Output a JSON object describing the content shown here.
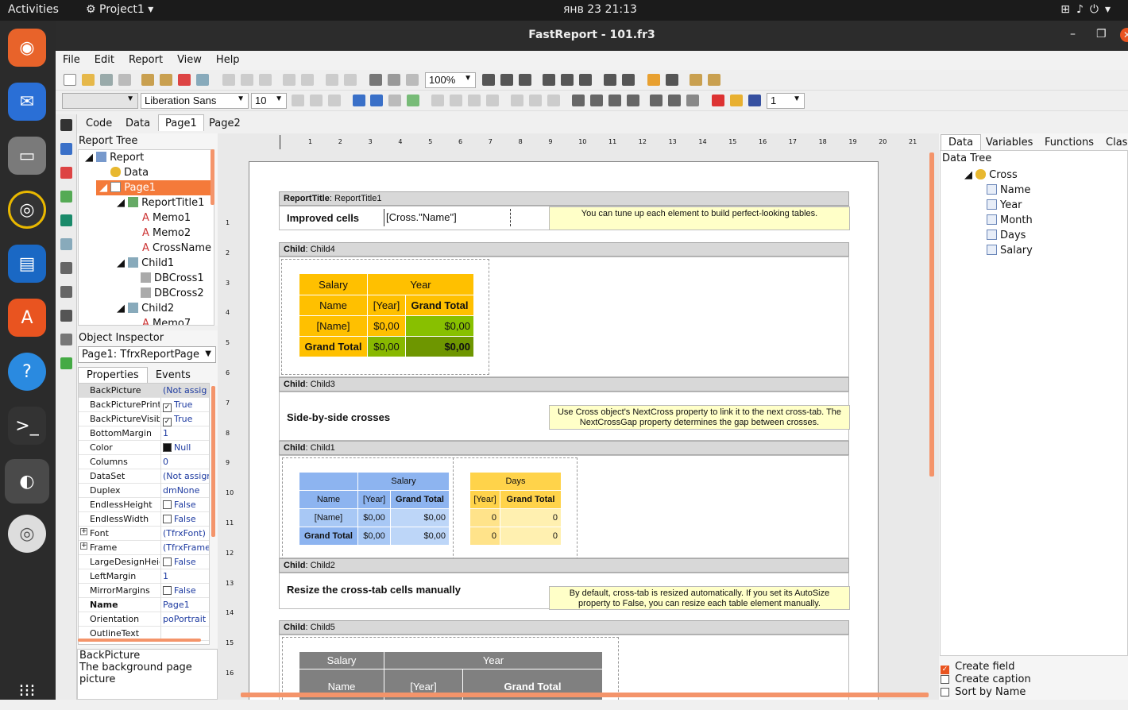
{
  "topbar": {
    "activities": "Activities",
    "project": "Project1",
    "clock": "янв 23  21:13"
  },
  "window": {
    "title": "FastReport - 101.fr3"
  },
  "menu": [
    "File",
    "Edit",
    "Report",
    "View",
    "Help"
  ],
  "toolbar": {
    "zoom": "100%",
    "font": "Liberation Sans",
    "size": "10",
    "frame_width": "1"
  },
  "designer_tabs": [
    "Code",
    "Data",
    "Page1",
    "Page2"
  ],
  "report_tree": {
    "title": "Report Tree",
    "items": [
      {
        "label": "Report",
        "level": 1
      },
      {
        "label": "Data",
        "level": 2
      },
      {
        "label": "Page1",
        "level": 2,
        "selected": true
      },
      {
        "label": "ReportTitle1",
        "level": 3
      },
      {
        "label": "Memo1",
        "level": 4
      },
      {
        "label": "Memo2",
        "level": 4
      },
      {
        "label": "CrossName",
        "level": 4
      },
      {
        "label": "Child1",
        "level": 3
      },
      {
        "label": "DBCross1",
        "level": 4
      },
      {
        "label": "DBCross2",
        "level": 4
      },
      {
        "label": "Child2",
        "level": 3
      },
      {
        "label": "Memo7",
        "level": 4
      }
    ]
  },
  "object_inspector": {
    "title": "Object Inspector",
    "selected": "Page1: TfrxReportPage",
    "tabs": [
      "Properties",
      "Events"
    ],
    "props": [
      {
        "name": "BackPicture",
        "value": "(Not assig"
      },
      {
        "name": "BackPicturePrintable",
        "value": "True",
        "check": true
      },
      {
        "name": "BackPictureVisible",
        "value": "True",
        "check": true
      },
      {
        "name": "BottomMargin",
        "value": "1"
      },
      {
        "name": "Color",
        "value": "Null",
        "swatch": true
      },
      {
        "name": "Columns",
        "value": "0"
      },
      {
        "name": "DataSet",
        "value": "(Not assign"
      },
      {
        "name": "Duplex",
        "value": "dmNone"
      },
      {
        "name": "EndlessHeight",
        "value": "False",
        "check": false
      },
      {
        "name": "EndlessWidth",
        "value": "False",
        "check": false
      },
      {
        "name": "Font",
        "value": "(TfrxFont)",
        "plus": true
      },
      {
        "name": "Frame",
        "value": "(TfrxFrame)",
        "plus": true
      },
      {
        "name": "LargeDesignHeight",
        "value": "False",
        "check": false
      },
      {
        "name": "LeftMargin",
        "value": "1"
      },
      {
        "name": "MirrorMargins",
        "value": "False",
        "check": false
      },
      {
        "name": "Name",
        "value": "Page1",
        "bold": true
      },
      {
        "name": "Orientation",
        "value": "poPortrait"
      },
      {
        "name": "OutlineText",
        "value": ""
      }
    ],
    "description_title": "BackPicture",
    "description_text": "The background page picture"
  },
  "ruler_numbers": [
    "1",
    "2",
    "3",
    "4",
    "5",
    "6",
    "7",
    "8",
    "9",
    "10",
    "11",
    "12",
    "13",
    "14",
    "15",
    "16",
    "17",
    "18",
    "19",
    "20",
    "21"
  ],
  "report": {
    "title_band": {
      "kind": "ReportTitle",
      "name": ": ReportTitle1"
    },
    "improved": {
      "label": "Improved cells",
      "field": "[Cross.\"Name\"]",
      "note": "You can tune up each element to build perfect-looking tables."
    },
    "child4": {
      "kind": "Child",
      "name": ": Child4"
    },
    "cross1": {
      "h1": "Salary",
      "h2": "Year",
      "name": "Name",
      "year": "[Year]",
      "gt": "Grand Total",
      "rname": "[Name]",
      "v1": "$0,00",
      "v2": "$0,00",
      "rgt": "Grand Total",
      "v3": "$0,00",
      "v4": "$0,00"
    },
    "child3": {
      "kind": "Child",
      "name": ": Child3"
    },
    "side": {
      "label": "Side-by-side crosses",
      "note": "Use Cross object's NextCross property to link it to the next cross-tab. The NextCrossGap property determines the gap between crosses."
    },
    "child1": {
      "kind": "Child",
      "name": ": Child1"
    },
    "cross2": {
      "h1": "Salary",
      "name": "Name",
      "year": "[Year]",
      "gt": "Grand Total",
      "rname": "[Name]",
      "v1": "$0,00",
      "v2": "$0,00",
      "rgt": "Grand Total",
      "v3": "$0,00",
      "v4": "$0,00"
    },
    "cross3": {
      "h1": "Days",
      "year": "[Year]",
      "gt": "Grand Total",
      "v1": "0",
      "v2": "0",
      "v3": "0",
      "v4": "0"
    },
    "child2": {
      "kind": "Child",
      "name": ": Child2"
    },
    "resize": {
      "label": "Resize the cross-tab cells manually",
      "note": "By default, cross-tab is resized automatically. If you set its AutoSize property to False, you can resize each table element manually."
    },
    "child5": {
      "kind": "Child",
      "name": ": Child5"
    },
    "cross4": {
      "h1": "Salary",
      "h2": "Year",
      "name": "Name",
      "year": "[Year]",
      "gt": "Grand Total"
    }
  },
  "data_panel": {
    "tabs": [
      "Data",
      "Variables",
      "Functions",
      "Clas"
    ],
    "title": "Data Tree",
    "root": "Cross",
    "fields": [
      "Name",
      "Year",
      "Month",
      "Days",
      "Salary"
    ],
    "options": [
      {
        "label": "Create field",
        "checked": true
      },
      {
        "label": "Create caption",
        "checked": false
      },
      {
        "label": "Sort by Name",
        "checked": false
      }
    ]
  },
  "colors": {
    "accent": "#f47a3a",
    "cross1_header": "#ffc000",
    "cross1_total": "#88b800",
    "cross2_header": "#8db4f0",
    "cross3_header": "#ffd34a",
    "cross4_header": "#808080"
  }
}
